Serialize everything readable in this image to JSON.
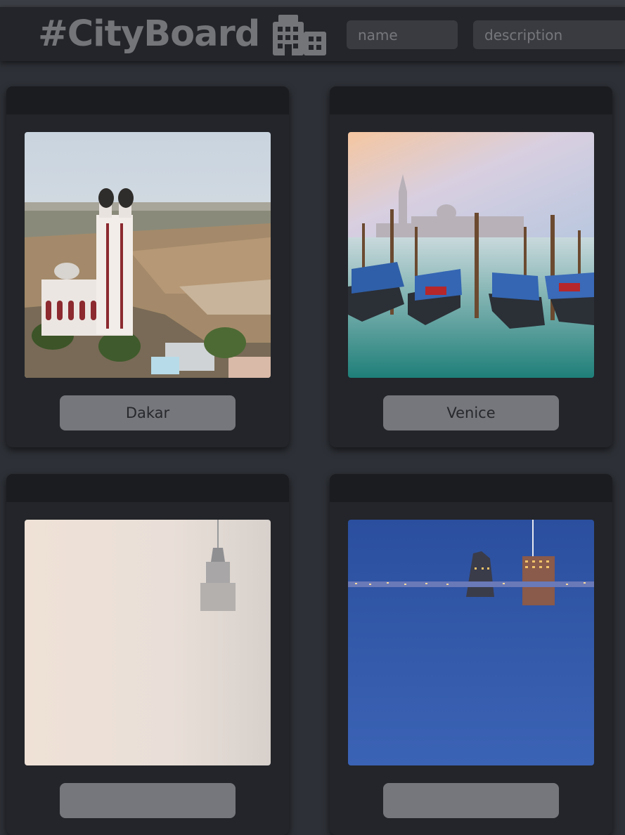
{
  "header": {
    "title": "#CityBoard",
    "title_icon": "city-buildings-icon",
    "name_placeholder": "name",
    "description_placeholder": "description"
  },
  "cards": [
    {
      "label": "Dakar"
    },
    {
      "label": "Venice"
    },
    {
      "label": ""
    },
    {
      "label": ""
    }
  ],
  "colors": {
    "page_background": "#2d3036",
    "header_background": "#23252a",
    "card_background": "#23252a",
    "card_header": "#1b1c20",
    "label_button": "#76777c",
    "title_text": "#747579"
  }
}
